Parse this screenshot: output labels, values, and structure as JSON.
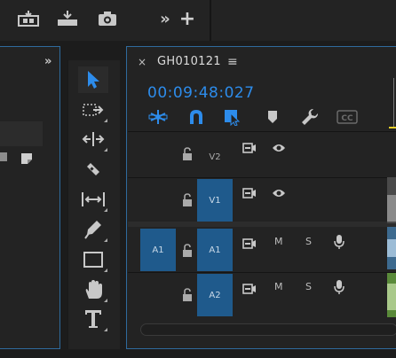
{
  "toolbar": {
    "icons": [
      "insert-clip-icon",
      "overwrite-clip-icon",
      "camera-icon",
      "more-chevron-icon",
      "add-icon"
    ],
    "more_glyph": "»",
    "add_glyph": "+"
  },
  "left_panel": {
    "chevron_glyph": "»"
  },
  "tools": [
    "selection-tool-icon",
    "track-select-tool-icon",
    "ripple-edit-tool-icon",
    "razor-tool-icon",
    "slip-tool-icon",
    "pen-tool-icon",
    "rectangle-tool-icon",
    "hand-tool-icon",
    "type-tool-icon"
  ],
  "timeline": {
    "close_glyph": "×",
    "sequence_name": "GH010121",
    "menu_glyph": "≡",
    "timecode": "00:09:48:027",
    "timecode_color": "#2d8ceb",
    "controls": [
      "nest-toggle-icon",
      "snap-magnet-icon",
      "linked-selection-icon",
      "add-marker-icon",
      "wrench-icon",
      "captions-icon"
    ],
    "captions_label": "CC",
    "tracks": [
      {
        "source": "",
        "target": "V2",
        "mute": "",
        "solo": ""
      },
      {
        "source": "",
        "target": "V1",
        "mute": "",
        "solo": ""
      },
      {
        "source": "A1",
        "target": "A1",
        "mute": "M",
        "solo": "S"
      },
      {
        "source": "",
        "target": "A2",
        "mute": "M",
        "solo": "S"
      }
    ]
  },
  "colors": {
    "accent": "#2d8ceb",
    "track_active": "#1f5a8c",
    "panel_border": "#2f6a9d"
  }
}
